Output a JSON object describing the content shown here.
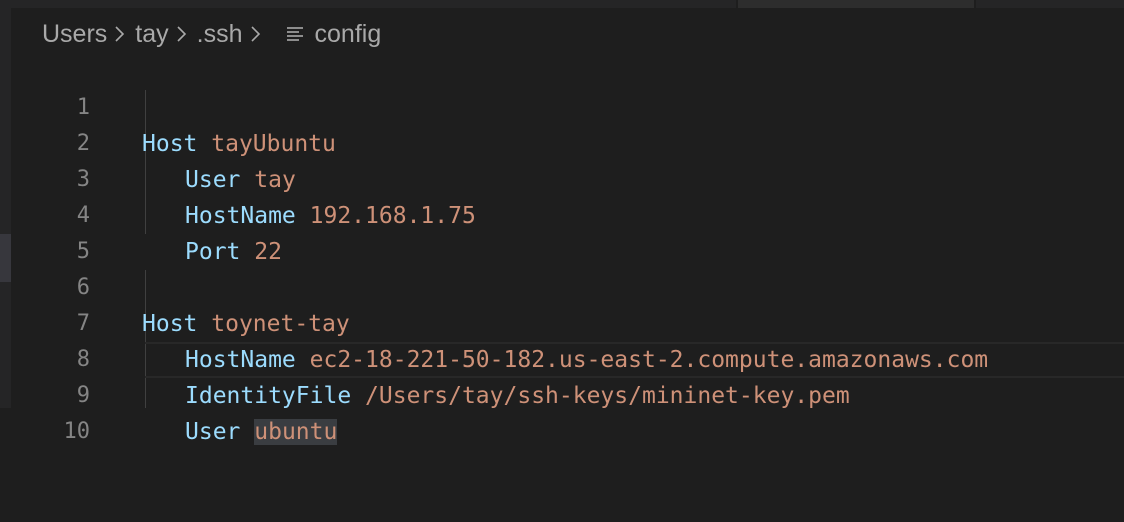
{
  "breadcrumb": {
    "items": [
      "Users",
      "tay",
      ".ssh"
    ],
    "file_icon": "list-lines-icon",
    "file": "config"
  },
  "editor": {
    "lines": [
      {
        "number": "1",
        "indent": false,
        "key": "Host",
        "value": "tayUbuntu"
      },
      {
        "number": "2",
        "indent": true,
        "key": "User",
        "value": "tay"
      },
      {
        "number": "3",
        "indent": true,
        "key": "HostName",
        "value": "192.168.1.75"
      },
      {
        "number": "4",
        "indent": true,
        "key": "Port",
        "value": "22"
      },
      {
        "number": "5",
        "indent": false,
        "key": "",
        "value": ""
      },
      {
        "number": "6",
        "indent": false,
        "key": "Host",
        "value": "toynet-tay"
      },
      {
        "number": "7",
        "indent": true,
        "key": "HostName",
        "value": "ec2-18-221-50-182.us-east-2.compute.amazonaws.com"
      },
      {
        "number": "8",
        "indent": true,
        "key": "IdentityFile",
        "value": "/Users/tay/ssh-keys/mininet-key.pem"
      },
      {
        "number": "9",
        "indent": true,
        "key": "User",
        "value": "ubuntu"
      },
      {
        "number": "10",
        "indent": false,
        "key": "",
        "value": ""
      }
    ],
    "current_line": "9"
  },
  "colors": {
    "background": "#1e1e1e",
    "keyword": "#9cdcfe",
    "value": "#ce9178",
    "line_number": "#858585",
    "breadcrumb": "#a9a9a9"
  }
}
